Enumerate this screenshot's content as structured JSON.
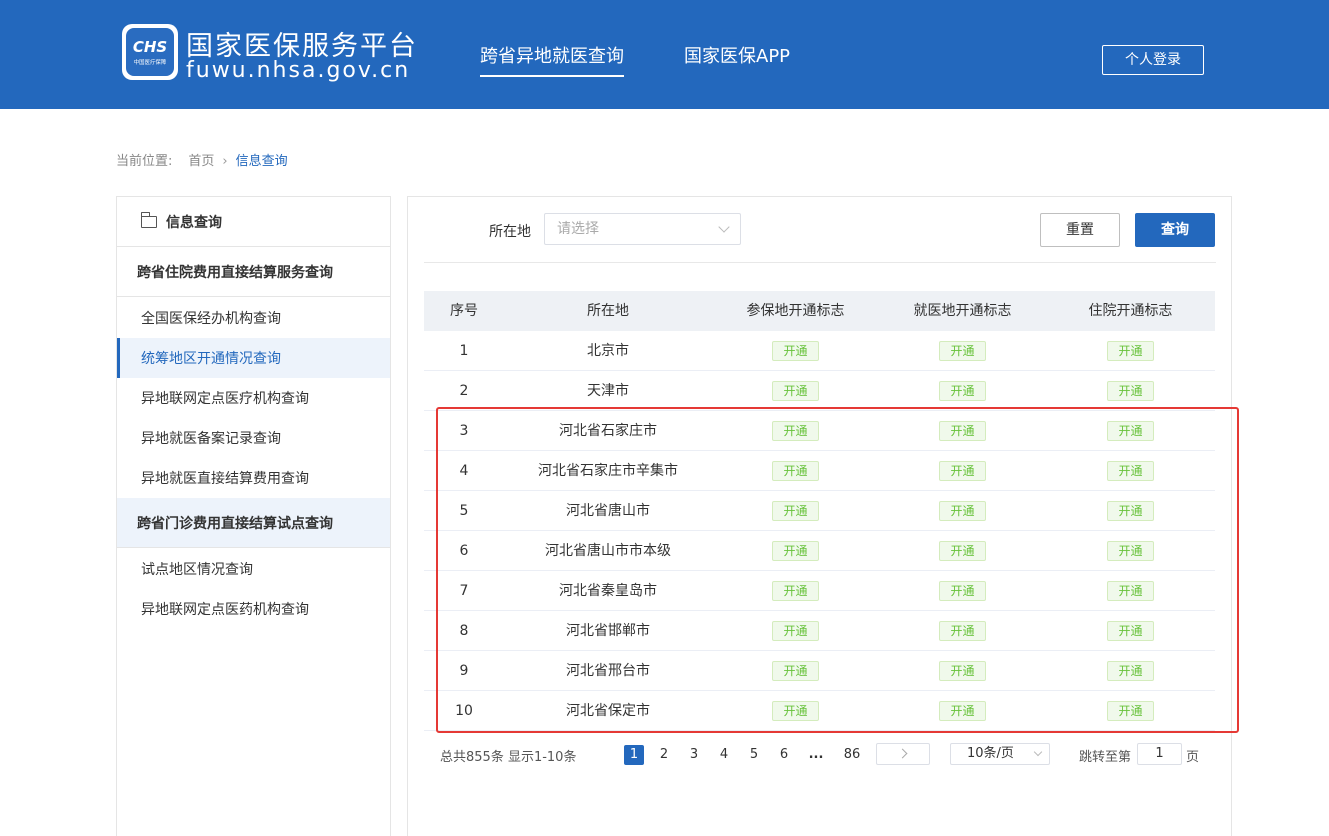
{
  "header": {
    "logo_text": "CHS",
    "logo_sub": "中国医疗保障",
    "site_title": "国家医保服务平台",
    "site_domain": "fuwu.nhsa.gov.cn",
    "nav": [
      "跨省异地就医查询",
      "国家医保APP"
    ],
    "login_label": "个人登录"
  },
  "breadcrumb": {
    "prefix": "当前位置:",
    "home": "首页",
    "separator": "›",
    "current": "信息查询"
  },
  "sidebar": {
    "title": "信息查询",
    "group1": "跨省住院费用直接结算服务查询",
    "group1_items": [
      "全国医保经办机构查询",
      "统筹地区开通情况查询",
      "异地联网定点医疗机构查询",
      "异地就医备案记录查询",
      "异地就医直接结算费用查询"
    ],
    "group2": "跨省门诊费用直接结算试点查询",
    "group2_items": [
      "试点地区情况查询",
      "异地联网定点医药机构查询"
    ]
  },
  "filter": {
    "label": "所在地",
    "placeholder": "请选择",
    "reset_label": "重置",
    "query_label": "查询"
  },
  "table": {
    "headers": [
      "序号",
      "所在地",
      "参保地开通标志",
      "就医地开通标志",
      "住院开通标志"
    ],
    "tag_label": "开通",
    "rows": [
      {
        "no": "1",
        "location": "北京市"
      },
      {
        "no": "2",
        "location": "天津市"
      },
      {
        "no": "3",
        "location": "河北省石家庄市"
      },
      {
        "no": "4",
        "location": "河北省石家庄市辛集市"
      },
      {
        "no": "5",
        "location": "河北省唐山市"
      },
      {
        "no": "6",
        "location": "河北省唐山市市本级"
      },
      {
        "no": "7",
        "location": "河北省秦皇岛市"
      },
      {
        "no": "8",
        "location": "河北省邯郸市"
      },
      {
        "no": "9",
        "location": "河北省邢台市"
      },
      {
        "no": "10",
        "location": "河北省保定市"
      }
    ]
  },
  "pagination": {
    "total_text": "总共855条  显示1-10条",
    "pages": [
      "1",
      "2",
      "3",
      "4",
      "5",
      "6",
      "...",
      "86"
    ],
    "page_size": "10条/页",
    "jump_label": "跳转至第",
    "jump_value": "1",
    "page_suffix": "页"
  },
  "colors": {
    "brand_blue": "#2368bd",
    "tag_green": "#67c23a",
    "highlight_red": "#e53935"
  }
}
